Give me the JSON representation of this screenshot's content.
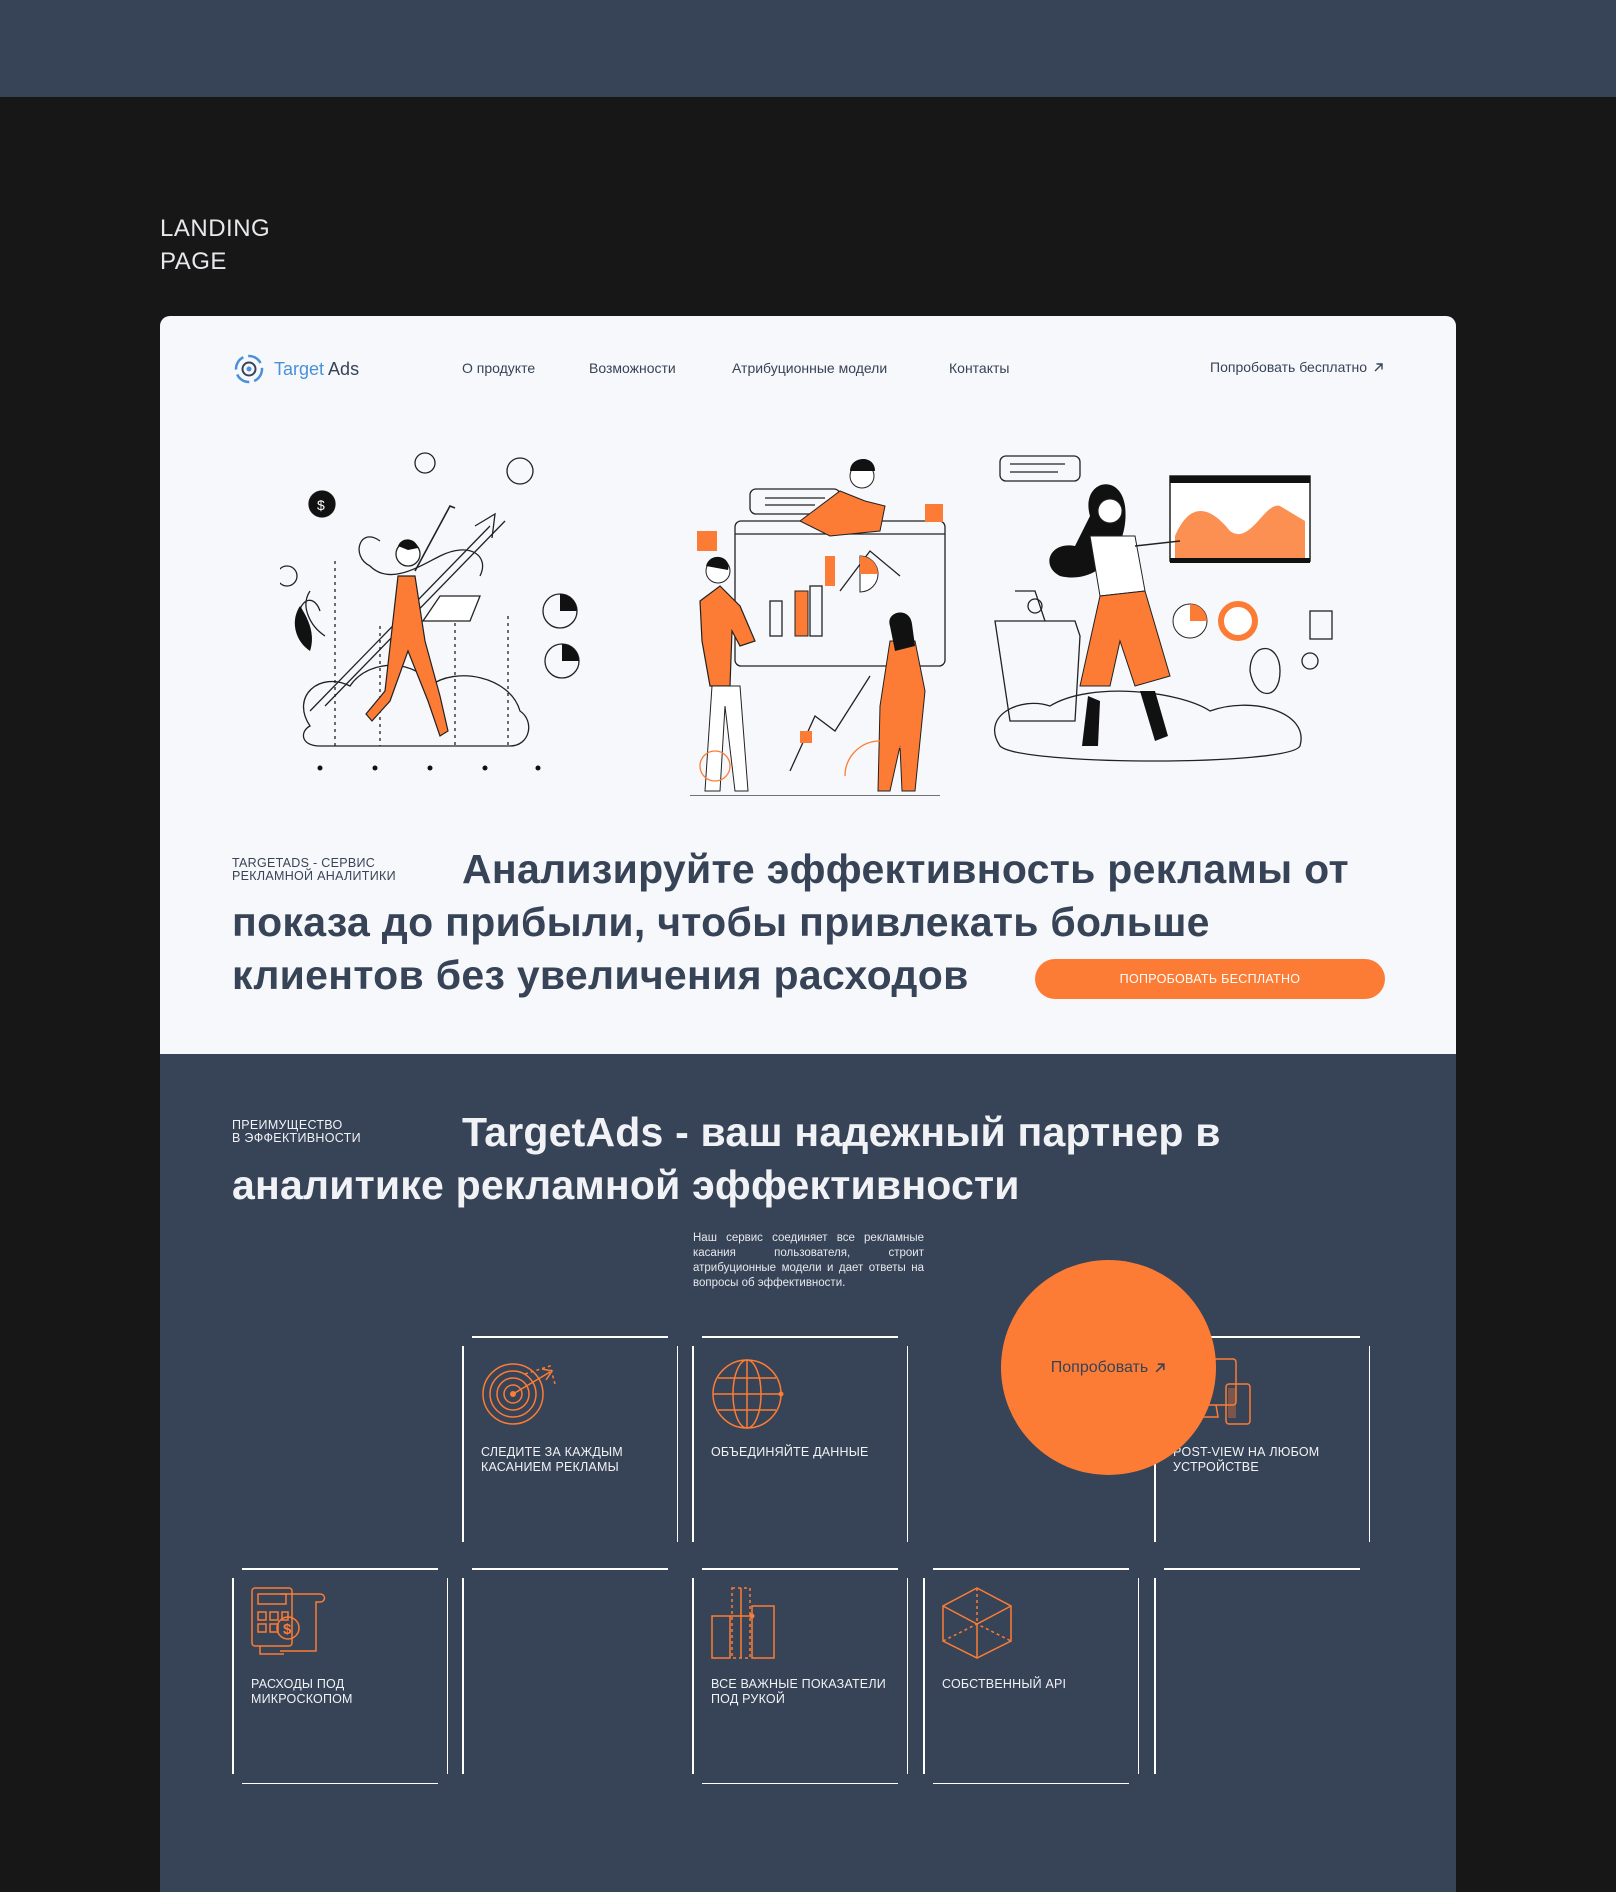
{
  "caption": {
    "line1": "LANDING",
    "line2": "PAGE"
  },
  "header": {
    "logo_part1": "Target",
    "logo_part2": "Ads",
    "nav": [
      "О продукте",
      "Возможности",
      "Атрибуционные модели",
      "Контакты"
    ],
    "try_link": "Попробовать бесплатно"
  },
  "hero": {
    "kicker_line1": "TARGETADS - СЕРВИС",
    "kicker_line2": "РЕКЛАМНОЙ АНАЛИТИКИ",
    "headline": "Анализируйте эффективность рекламы от показа до прибыли, чтобы привлекать больше клиентов без увеличения расходов",
    "cta": "ПОПРОБОВАТЬ БЕСПЛАТНО"
  },
  "advantages": {
    "kicker_line1": "ПРЕИМУЩЕСТВО",
    "kicker_line2": "В ЭФФЕКТИВНОСТИ",
    "title": "TargetAds - ваш надежный партнер в аналитике рекламной эффективности",
    "description": "Наш сервис соединяет все рекламные касания пользователя, строит атрибуционные модели и дает ответы на вопросы об эффективности.",
    "cards": [
      {
        "icon": "target-icon",
        "label": "СЛЕДИТЕ ЗА КАЖДЫМ КАСАНИЕМ РЕКЛАМЫ"
      },
      {
        "icon": "globe-icon",
        "label": "ОБЪЕДИНЯЙТЕ ДАННЫЕ"
      },
      {
        "icon": "devices-icon",
        "label": "POST-VIEW НА ЛЮБОМ УСТРОЙСТВЕ"
      },
      {
        "icon": "calculator-receipt-icon",
        "label": "РАСХОДЫ ПОД МИКРОСКОПОМ"
      },
      {
        "icon": "bar-chart-icon",
        "label": "ВСЕ ВАЖНЫЕ ПОКАЗАТЕЛИ ПОД РУКОЙ"
      },
      {
        "icon": "cube-icon",
        "label": "СОБСТВЕННЫЙ API"
      }
    ],
    "circle_cta": "Попробовать"
  },
  "colors": {
    "accent": "#fc7c35",
    "navy": "#374356",
    "hero_bg": "#f7f8fc",
    "outer_bg": "#171717"
  }
}
